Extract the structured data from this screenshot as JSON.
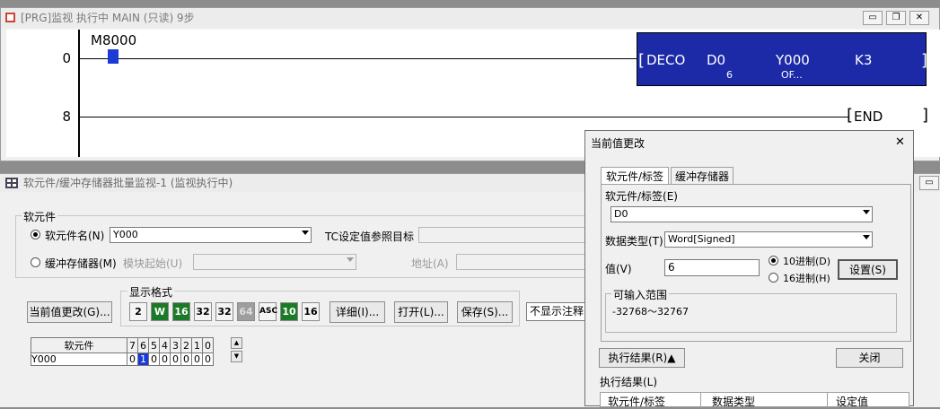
{
  "program_window": {
    "title": "[PRG]监视 执行中 MAIN (只读) 9步",
    "minimize": "▭",
    "restore": "❐",
    "close": "✕",
    "rung0": {
      "step": "0",
      "contact_device": "M8000"
    },
    "deco": {
      "instruction": "DECO",
      "src": "D0",
      "src_value": "6",
      "dst": "Y000",
      "dst_value": "OF...",
      "count": "K3",
      "open": "[",
      "close": "]"
    },
    "rung8": {
      "step": "8",
      "instruction": "END",
      "open": "[",
      "close": "]"
    }
  },
  "batch_window": {
    "title": "软元件/缓冲存储器批量监视-1 (监视执行中)",
    "group_label": "软元件",
    "radio_device_label": "软元件名(N)",
    "device_value": "Y000",
    "tc_label": "TC设定值参照目标",
    "radio_buffer_label": "缓冲存储器(M)",
    "module_start_label": "模块起始(U)",
    "address_label": "地址(A)",
    "change_button": "当前值更改(G)...",
    "display_group_label": "显示格式",
    "format_buttons": [
      "2",
      "W",
      "16",
      "32",
      "32",
      "64",
      "ASC",
      "10",
      "16"
    ],
    "detail_button": "详细(I)...",
    "open_button": "打开(L)...",
    "save_button": "保存(S)...",
    "comment_combo": "不显示注释",
    "grid": {
      "header_label": "软元件",
      "bit_headers": [
        "7",
        "6",
        "5",
        "4",
        "3",
        "2",
        "1",
        "0"
      ],
      "row_device": "Y000",
      "bits": [
        "0",
        "1",
        "0",
        "0",
        "0",
        "0",
        "0",
        "0"
      ],
      "scroll_up": "▲",
      "scroll_down": "▼"
    }
  },
  "dialog": {
    "title": "当前值更改",
    "close": "✕",
    "tabs": [
      "软元件/标签",
      "缓冲存储器"
    ],
    "device_label": "软元件/标签(E)",
    "device_value": "D0",
    "datatype_label": "数据类型(T)",
    "datatype_value": "Word[Signed]",
    "value_label": "值(V)",
    "value": "6",
    "radix_dec": "10进制(D)",
    "radix_hex": "16进制(H)",
    "set_button": "设置(S)",
    "range_label": "可输入范围",
    "range_value": "-32768～32767",
    "result_toggle": "执行结果(R)▲",
    "close_button": "关闭",
    "result_label": "执行结果(L)",
    "result_columns": [
      "软元件/标签",
      "数据类型",
      "设定值"
    ]
  },
  "colors": {
    "instruction_block": "#1c2aa8",
    "contact_on": "#1b3ad6",
    "format_active": "#1b7a25"
  }
}
